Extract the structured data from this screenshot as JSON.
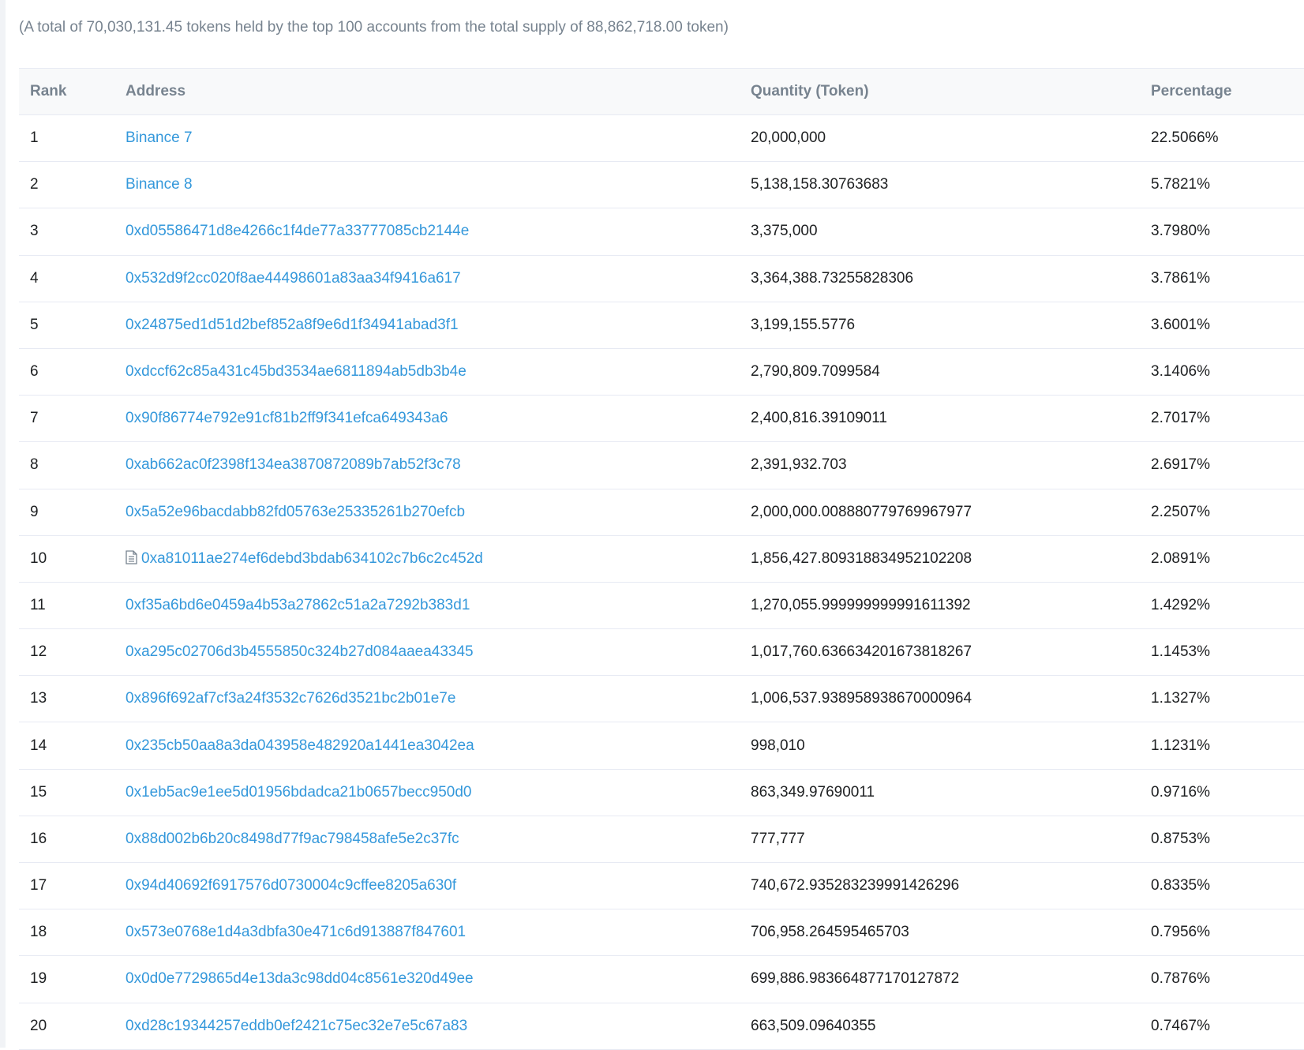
{
  "summary": "(A total of 70,030,131.45 tokens held by the top 100 accounts from the total supply of 88,862,718.00 token)",
  "table": {
    "headers": {
      "rank": "Rank",
      "address": "Address",
      "quantity": "Quantity (Token)",
      "percentage": "Percentage"
    },
    "rows": [
      {
        "rank": "1",
        "address": "Binance 7",
        "quantity": "20,000,000",
        "percentage": "22.5066%",
        "icon": ""
      },
      {
        "rank": "2",
        "address": "Binance 8",
        "quantity": "5,138,158.30763683",
        "percentage": "5.7821%",
        "icon": ""
      },
      {
        "rank": "3",
        "address": "0xd05586471d8e4266c1f4de77a33777085cb2144e",
        "quantity": "3,375,000",
        "percentage": "3.7980%",
        "icon": ""
      },
      {
        "rank": "4",
        "address": "0x532d9f2cc020f8ae44498601a83aa34f9416a617",
        "quantity": "3,364,388.73255828306",
        "percentage": "3.7861%",
        "icon": ""
      },
      {
        "rank": "5",
        "address": "0x24875ed1d51d2bef852a8f9e6d1f34941abad3f1",
        "quantity": "3,199,155.5776",
        "percentage": "3.6001%",
        "icon": ""
      },
      {
        "rank": "6",
        "address": "0xdccf62c85a431c45bd3534ae6811894ab5db3b4e",
        "quantity": "2,790,809.7099584",
        "percentage": "3.1406%",
        "icon": ""
      },
      {
        "rank": "7",
        "address": "0x90f86774e792e91cf81b2ff9f341efca649343a6",
        "quantity": "2,400,816.39109011",
        "percentage": "2.7017%",
        "icon": ""
      },
      {
        "rank": "8",
        "address": "0xab662ac0f2398f134ea3870872089b7ab52f3c78",
        "quantity": "2,391,932.703",
        "percentage": "2.6917%",
        "icon": ""
      },
      {
        "rank": "9",
        "address": "0x5a52e96bacdabb82fd05763e25335261b270efcb",
        "quantity": "2,000,000.008880779769967977",
        "percentage": "2.2507%",
        "icon": ""
      },
      {
        "rank": "10",
        "address": "0xa81011ae274ef6debd3bdab634102c7b6c2c452d",
        "quantity": "1,856,427.809318834952102208",
        "percentage": "2.0891%",
        "icon": "contract-icon"
      },
      {
        "rank": "11",
        "address": "0xf35a6bd6e0459a4b53a27862c51a2a7292b383d1",
        "quantity": "1,270,055.999999999991611392",
        "percentage": "1.4292%",
        "icon": ""
      },
      {
        "rank": "12",
        "address": "0xa295c02706d3b4555850c324b27d084aaea43345",
        "quantity": "1,017,760.636634201673818267",
        "percentage": "1.1453%",
        "icon": ""
      },
      {
        "rank": "13",
        "address": "0x896f692af7cf3a24f3532c7626d3521bc2b01e7e",
        "quantity": "1,006,537.938958938670000964",
        "percentage": "1.1327%",
        "icon": ""
      },
      {
        "rank": "14",
        "address": "0x235cb50aa8a3da043958e482920a1441ea3042ea",
        "quantity": "998,010",
        "percentage": "1.1231%",
        "icon": ""
      },
      {
        "rank": "15",
        "address": "0x1eb5ac9e1ee5d01956bdadca21b0657becc950d0",
        "quantity": "863,349.97690011",
        "percentage": "0.9716%",
        "icon": ""
      },
      {
        "rank": "16",
        "address": "0x88d002b6b20c8498d77f9ac798458afe5e2c37fc",
        "quantity": "777,777",
        "percentage": "0.8753%",
        "icon": ""
      },
      {
        "rank": "17",
        "address": "0x94d40692f6917576d0730004c9cffee8205a630f",
        "quantity": "740,672.935283239991426296",
        "percentage": "0.8335%",
        "icon": ""
      },
      {
        "rank": "18",
        "address": "0x573e0768e1d4a3dbfa30e471c6d913887f847601",
        "quantity": "706,958.264595465703",
        "percentage": "0.7956%",
        "icon": ""
      },
      {
        "rank": "19",
        "address": "0x0d0e7729865d4e13da3c98dd04c8561e320d49ee",
        "quantity": "699,886.983664877170127872",
        "percentage": "0.7876%",
        "icon": ""
      },
      {
        "rank": "20",
        "address": "0xd28c19344257eddb0ef2421c75ec32e7e5c67a83",
        "quantity": "663,509.09640355",
        "percentage": "0.7467%",
        "icon": ""
      }
    ]
  }
}
